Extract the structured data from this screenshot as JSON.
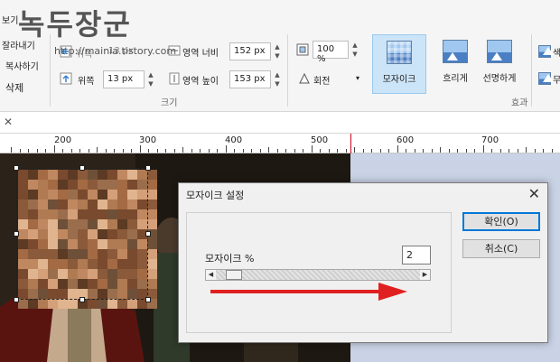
{
  "watermark": {
    "text": "녹두장군",
    "url": "http://mainia.tistory.com"
  },
  "clipboard": {
    "items": [
      "보기",
      "잘라내기",
      "복사하기",
      "삭제"
    ]
  },
  "position": {
    "x_label": "위쪽",
    "x_value": "161 px",
    "y_label": "위쪽",
    "y_value": "13 px"
  },
  "size": {
    "width_label": "영역 너비",
    "width_value": "152 px",
    "height_label": "영역 높이",
    "height_value": "153 px",
    "group_label": "크기"
  },
  "zoom": {
    "value": "100 %",
    "rotate_label": "회전"
  },
  "effects": {
    "items": [
      {
        "label": "모자이크",
        "icon": "mosaic-icon",
        "active": true
      },
      {
        "label": "흐리게",
        "icon": "blur-icon",
        "active": false
      },
      {
        "label": "선명하게",
        "icon": "sharpen-icon",
        "active": false
      }
    ],
    "group_label": "효과",
    "extra_items": [
      "색",
      "무"
    ]
  },
  "ruler": {
    "labels": [
      "200",
      "300",
      "400",
      "500",
      "600",
      "700"
    ],
    "marker_color": "#d0021b"
  },
  "dialog": {
    "title": "모자이크 설정",
    "close": "✕",
    "field_label": "모자이크 %",
    "value": "2",
    "ok_label": "확인(O)",
    "cancel_label": "취소(C)",
    "slider_percent": 5
  },
  "colors": {
    "accent": "#0078d7",
    "active_bg": "#cce4f7",
    "arrow": "#e02020"
  }
}
